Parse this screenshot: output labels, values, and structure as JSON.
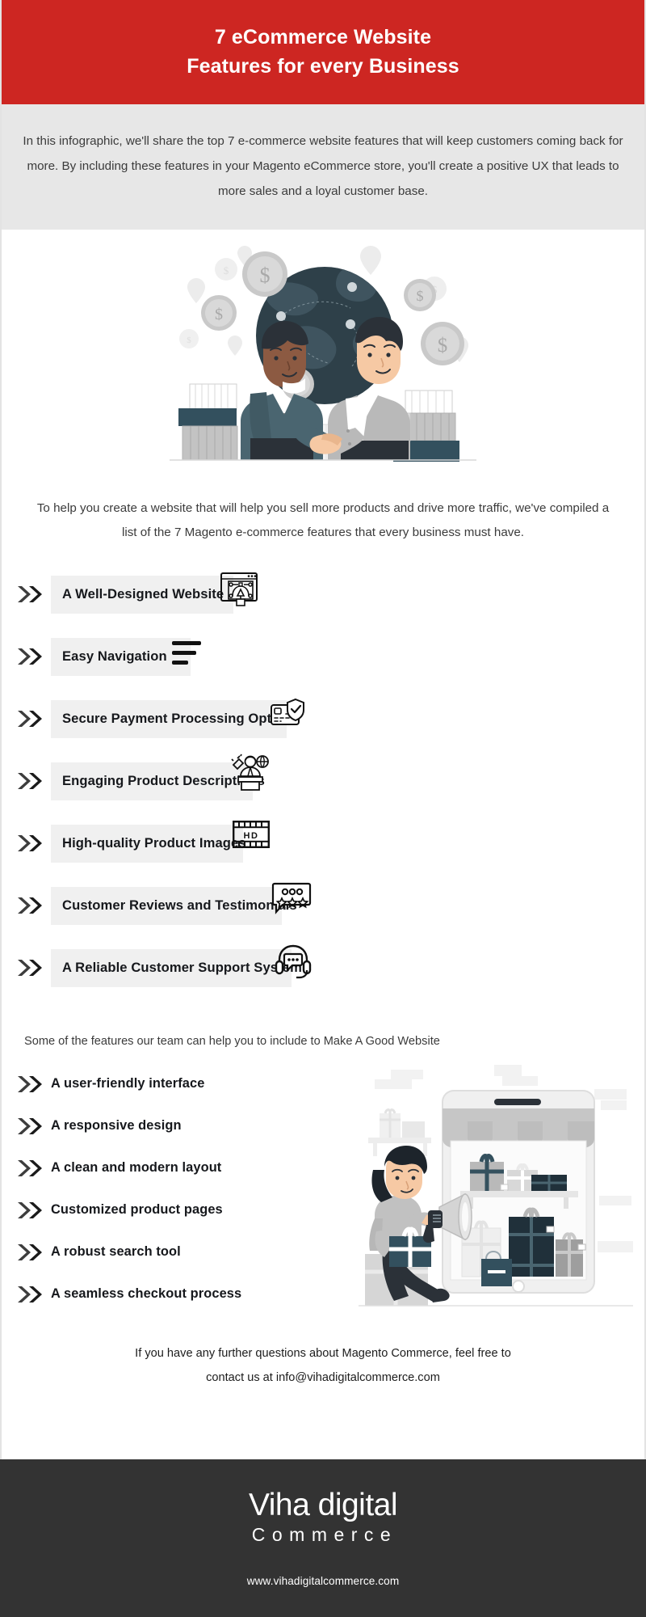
{
  "header": {
    "title_line1": "7 eCommerce Website",
    "title_line2": "Features for every Business",
    "background_color": "#cd2622",
    "text_color": "#ffffff"
  },
  "intro": {
    "paragraph": "In this infographic, we'll share the top 7 e-commerce website features that will keep customers coming back for more. By including these features in your Magento eCommerce store, you'll create a positive UX that leads to more sales and a loyal customer base.",
    "background_color": "#e7e7e7"
  },
  "hero_illustration": {
    "name": "business-handshake-globe-illustration",
    "alt": "Two businessmen shaking hands in front of a globe with dollar coins, location pins and shipping containers"
  },
  "lead": {
    "paragraph": "To help you create a website that will help you sell more products and drive more traffic, we've compiled a list of the 7 Magento e-commerce features that every business must have."
  },
  "features": [
    {
      "label": "A Well-Designed Website",
      "icon": "design-window-pen-tool-icon"
    },
    {
      "label": "Easy Navigation",
      "icon": "hamburger-menu-lines-icon"
    },
    {
      "label": "Secure Payment Processing Options",
      "icon": "secure-payment-card-shield-icon"
    },
    {
      "label": "Engaging Product Descriptions",
      "icon": "presenter-podium-globe-icon"
    },
    {
      "label": "High-quality Product Images",
      "icon": "hd-film-strip-icon"
    },
    {
      "label": "Customer Reviews and Testimonials",
      "icon": "review-speech-bubble-stars-icon"
    },
    {
      "label": "A Reliable Customer Support System",
      "icon": "headset-support-chat-icon"
    }
  ],
  "sub_lead": {
    "text": "Some of the features our team can help you to include to Make A Good Website"
  },
  "bullets": [
    {
      "label": "A user-friendly interface"
    },
    {
      "label": "A responsive design"
    },
    {
      "label": "A clean and modern layout"
    },
    {
      "label": "Customized product pages"
    },
    {
      "label": "A robust search tool"
    },
    {
      "label": "A seamless checkout process"
    }
  ],
  "shop_illustration": {
    "name": "woman-megaphone-mobile-shop-illustration",
    "alt": "Woman with a megaphone holding a gift box seated in front of a mobile phone styled as a gift shop"
  },
  "contact": {
    "line1": "If you have any further questions about Magento Commerce, feel free to",
    "line2": "contact us at info@vihadigitalcommerce.com"
  },
  "footer": {
    "logo_main": "Viha digital",
    "logo_sub": "Commerce",
    "url": "www.vihadigitalcommerce.com",
    "background_color": "#333333"
  },
  "theme": {
    "brand_red": "#cd2622",
    "pill_gray": "#f0f0f0",
    "band_gray": "#e7e7e7",
    "footer_dark": "#333333",
    "ink": "#16181c"
  }
}
